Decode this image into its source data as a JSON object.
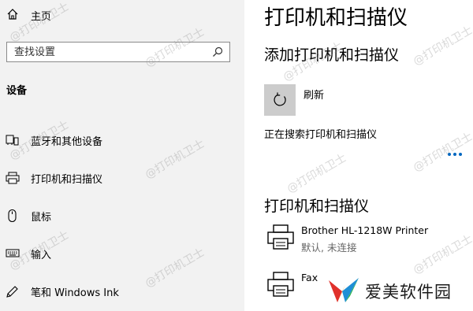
{
  "sidebar": {
    "home_label": "主页",
    "search_placeholder": "查找设置",
    "section_title": "设备",
    "items": [
      {
        "label": "蓝牙和其他设备",
        "icon": "bluetooth-devices-icon"
      },
      {
        "label": "打印机和扫描仪",
        "icon": "printer-icon"
      },
      {
        "label": "鼠标",
        "icon": "mouse-icon"
      },
      {
        "label": "输入",
        "icon": "keyboard-icon"
      },
      {
        "label": "笔和 Windows Ink",
        "icon": "pen-icon"
      }
    ]
  },
  "main": {
    "page_title": "打印机和扫描仪",
    "add_heading": "添加打印机和扫描仪",
    "refresh_label": "刷新",
    "searching_status": "正在搜索打印机和扫描仪",
    "list_heading": "打印机和扫描仪",
    "devices": [
      {
        "name": "Brother HL-1218W Printer",
        "status": "默认, 未连接"
      },
      {
        "name": "Fax",
        "status": ""
      }
    ]
  },
  "watermark_text": "@打印机卫士",
  "brand_text": "爱美软件园",
  "colors": {
    "sidebar_bg": "#f2f2f2",
    "accent": "#0067c0",
    "refresh_tile": "#cccccc"
  }
}
